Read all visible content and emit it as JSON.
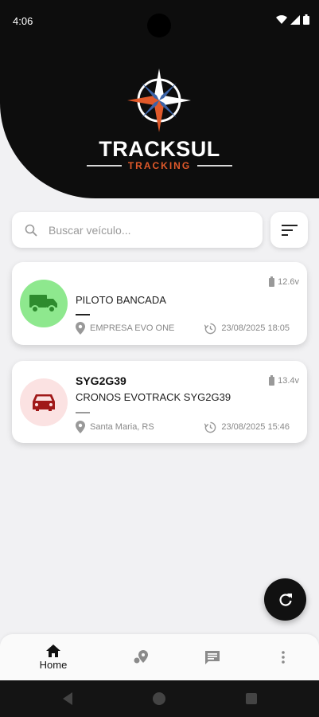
{
  "status_bar": {
    "time": "4:06"
  },
  "brand": {
    "name": "TRACKSUL",
    "subtitle": "TRACKING",
    "accent_color": "#e0592a"
  },
  "search": {
    "placeholder": "Buscar veículo..."
  },
  "vehicles": [
    {
      "plate": "",
      "title": "PILOTO BANCADA",
      "battery": "12.6v",
      "location": "EMPRESA EVO ONE",
      "timestamp": "23/08/2025 18:05",
      "icon": "truck-icon",
      "icon_color": "#2e8b2e",
      "avatar_bg": "#8ee88e"
    },
    {
      "plate": "SYG2G39",
      "title": "CRONOS EVOTRACK SYG2G39",
      "battery": "13.4v",
      "location": "Santa Maria, RS",
      "timestamp": "23/08/2025 15:46",
      "icon": "car-icon",
      "icon_color": "#a01818",
      "avatar_bg": "#fbe2e2"
    }
  ],
  "bottom_nav": {
    "home_label": "Home",
    "items": [
      "home-icon",
      "map-pin-icon",
      "chat-icon",
      "more-icon"
    ]
  }
}
